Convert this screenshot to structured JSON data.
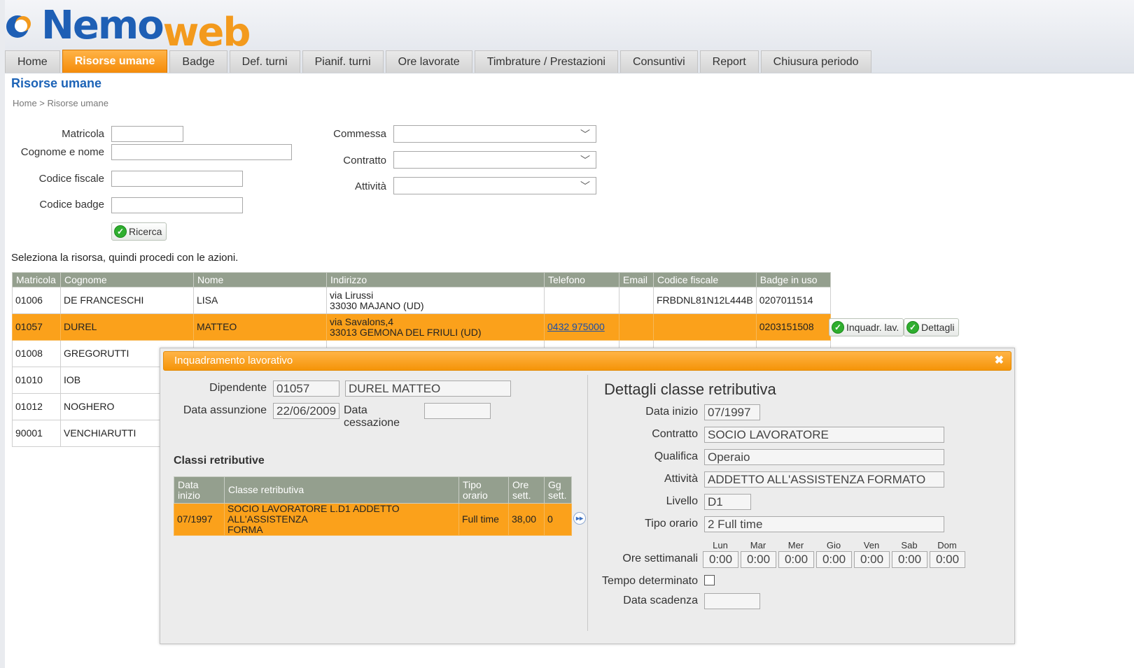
{
  "logo": {
    "part1": "Nemo",
    "part2": "web"
  },
  "tabs": [
    {
      "label": "Home",
      "active": false
    },
    {
      "label": "Risorse umane",
      "active": true
    },
    {
      "label": "Badge",
      "active": false
    },
    {
      "label": "Def. turni",
      "active": false
    },
    {
      "label": "Pianif. turni",
      "active": false
    },
    {
      "label": "Ore lavorate",
      "active": false
    },
    {
      "label": "Timbrature / Prestazioni",
      "active": false
    },
    {
      "label": "Consuntivi",
      "active": false
    },
    {
      "label": "Report",
      "active": false
    },
    {
      "label": "Chiusura periodo",
      "active": false
    }
  ],
  "page_title": "Risorse umane",
  "breadcrumb": "Home > Risorse umane",
  "search": {
    "matricola_label": "Matricola",
    "cognome_label": "Cognome e nome",
    "codice_fiscale_label": "Codice fiscale",
    "codice_badge_label": "Codice badge",
    "commessa_label": "Commessa",
    "contratto_label": "Contratto",
    "attivita_label": "Attività",
    "ricerca_button": "Ricerca"
  },
  "instruction": "Seleziona la risorsa, quindi procedi con le azioni.",
  "table": {
    "headers": [
      "Matricola",
      "Cognome",
      "Nome",
      "Indirizzo",
      "Telefono",
      "Email",
      "Codice fiscale",
      "Badge in uso"
    ],
    "rows": [
      {
        "matricola": "01006",
        "cognome": "DE FRANCESCHI",
        "nome": "LISA",
        "indirizzo1": "via Lirussi",
        "indirizzo2": "33030 MAJANO (UD)",
        "telefono": "",
        "email": "",
        "cf": "FRBDNL81N12L444B",
        "badge": "0207011514"
      },
      {
        "matricola": "01057",
        "cognome": "DUREL",
        "nome": "MATTEO",
        "indirizzo1": "via Savalons,4",
        "indirizzo2": "33013 GEMONA DEL FRIULI (UD)",
        "telefono": "0432 975000",
        "email": "",
        "cf": "",
        "badge": "0203151508"
      },
      {
        "matricola": "01008",
        "cognome": "GREGORUTTI"
      },
      {
        "matricola": "01010",
        "cognome": "IOB"
      },
      {
        "matricola": "01012",
        "cognome": "NOGHERO"
      },
      {
        "matricola": "90001",
        "cognome": "VENCHIARUTTI"
      }
    ],
    "inquadr_button": "Inquadr. lav.",
    "dettagli_button": "Dettagli"
  },
  "dialog": {
    "title": "Inquadramento lavorativo",
    "dipendente_label": "Dipendente",
    "dipendente_code": "01057",
    "dipendente_name": "DUREL MATTEO",
    "data_assunzione_label": "Data assunzione",
    "data_assunzione": "22/06/2009",
    "data_cessazione_label": "Data cessazione",
    "data_cessazione": "",
    "classi_title": "Classi retributive",
    "classi_headers": {
      "data1": "Data",
      "data2": "inizio",
      "classe": "Classe retributiva",
      "tipo1": "Tipo",
      "tipo2": "orario",
      "ore1": "Ore",
      "ore2": "sett.",
      "gg1": "Gg",
      "gg2": "sett."
    },
    "classi_row": {
      "data": "07/1997",
      "classe1": "SOCIO LAVORATORE L.D1 ADDETTO ALL'ASSISTENZA",
      "classe2": "FORMA",
      "tipo": "Full time",
      "ore": "38,00",
      "gg": "0"
    },
    "details": {
      "title": "Dettagli classe retributiva",
      "data_inizio_label": "Data inizio",
      "data_inizio": "07/1997",
      "contratto_label": "Contratto",
      "contratto": "SOCIO LAVORATORE",
      "qualifica_label": "Qualifica",
      "qualifica": "Operaio",
      "attivita_label": "Attività",
      "attivita": "ADDETTO ALL'ASSISTENZA FORMATO",
      "livello_label": "Livello",
      "livello": "D1",
      "tipo_orario_label": "Tipo orario",
      "tipo_orario": "2 Full time",
      "ore_settimanali_label": "Ore settimanali",
      "days": [
        {
          "label": "Lun",
          "value": "0:00"
        },
        {
          "label": "Mar",
          "value": "0:00"
        },
        {
          "label": "Mer",
          "value": "0:00"
        },
        {
          "label": "Gio",
          "value": "0:00"
        },
        {
          "label": "Ven",
          "value": "0:00"
        },
        {
          "label": "Sab",
          "value": "0:00"
        },
        {
          "label": "Dom",
          "value": "0:00"
        }
      ],
      "tempo_determinato_label": "Tempo determinato",
      "data_scadenza_label": "Data scadenza",
      "data_scadenza": ""
    }
  }
}
